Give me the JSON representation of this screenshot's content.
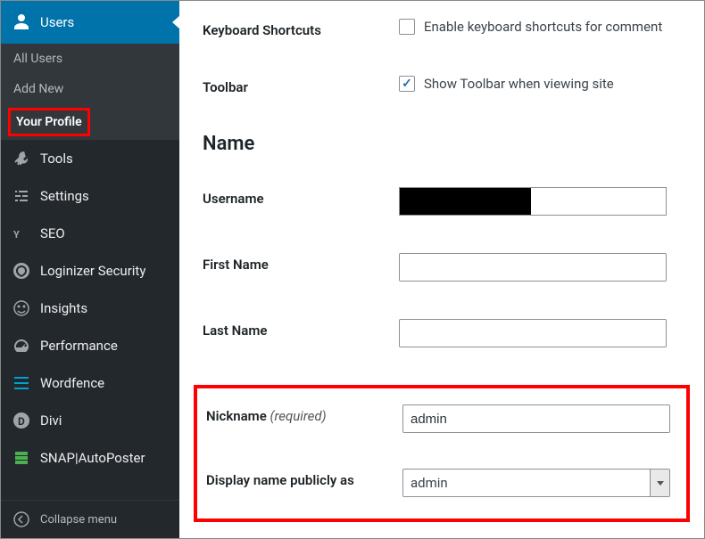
{
  "sidebar": {
    "users": {
      "label": "Users",
      "subitems": [
        {
          "label": "All Users"
        },
        {
          "label": "Add New"
        },
        {
          "label": "Your Profile"
        }
      ]
    },
    "items": [
      {
        "icon": "tools-icon",
        "label": "Tools"
      },
      {
        "icon": "settings-icon",
        "label": "Settings"
      },
      {
        "icon": "seo-icon",
        "label": "SEO"
      },
      {
        "icon": "shield-icon",
        "label": "Loginizer Security"
      },
      {
        "icon": "insights-icon",
        "label": "Insights"
      },
      {
        "icon": "gauge-icon",
        "label": "Performance"
      },
      {
        "icon": "wordfence-icon",
        "label": "Wordfence"
      },
      {
        "icon": "divi-icon",
        "label": "Divi"
      },
      {
        "icon": "snap-icon",
        "label": "SNAP|AutoPoster"
      }
    ],
    "collapse": "Collapse menu"
  },
  "form": {
    "keyboard_shortcuts": {
      "label": "Keyboard Shortcuts",
      "text": "Enable keyboard shortcuts for comment",
      "checked": false
    },
    "toolbar": {
      "label": "Toolbar",
      "text": "Show Toolbar when viewing site",
      "checked": true
    },
    "section_name": "Name",
    "username": {
      "label": "Username"
    },
    "first_name": {
      "label": "First Name",
      "value": ""
    },
    "last_name": {
      "label": "Last Name",
      "value": ""
    },
    "nickname": {
      "label": "Nickname",
      "required": "(required)",
      "value": "admin"
    },
    "display_name": {
      "label": "Display name publicly as",
      "value": "admin"
    }
  }
}
